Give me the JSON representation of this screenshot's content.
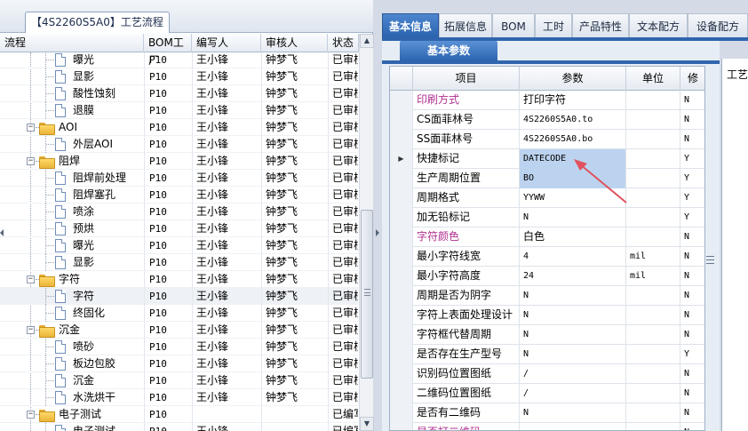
{
  "left_panel": {
    "tab_title": "【4S2260S5A0】工艺流程",
    "columns": [
      "流程",
      "BOM工厂",
      "编写人",
      "审核人",
      "状态"
    ],
    "rows": [
      {
        "kind": "leaf",
        "name": "曝光",
        "bom": "P10",
        "author": "王小锋",
        "reviewer": "钟梦飞",
        "status": "已审核"
      },
      {
        "kind": "leaf",
        "name": "显影",
        "bom": "P10",
        "author": "王小锋",
        "reviewer": "钟梦飞",
        "status": "已审核"
      },
      {
        "kind": "leaf",
        "name": "酸性蚀刻",
        "bom": "P10",
        "author": "王小锋",
        "reviewer": "钟梦飞",
        "status": "已审核"
      },
      {
        "kind": "leaf",
        "name": "退膜",
        "bom": "P10",
        "author": "王小锋",
        "reviewer": "钟梦飞",
        "status": "已审核"
      },
      {
        "kind": "folder",
        "name": "AOI",
        "bom": "P10",
        "author": "王小锋",
        "reviewer": "钟梦飞",
        "status": "已审核"
      },
      {
        "kind": "leaf",
        "name": "外层AOI",
        "bom": "P10",
        "author": "王小锋",
        "reviewer": "钟梦飞",
        "status": "已审核"
      },
      {
        "kind": "folder",
        "name": "阻焊",
        "bom": "P10",
        "author": "王小锋",
        "reviewer": "钟梦飞",
        "status": "已审核"
      },
      {
        "kind": "leaf",
        "name": "阻焊前处理",
        "bom": "P10",
        "author": "王小锋",
        "reviewer": "钟梦飞",
        "status": "已审核"
      },
      {
        "kind": "leaf",
        "name": "阻焊塞孔",
        "bom": "P10",
        "author": "王小锋",
        "reviewer": "钟梦飞",
        "status": "已审核"
      },
      {
        "kind": "leaf",
        "name": "喷涂",
        "bom": "P10",
        "author": "王小锋",
        "reviewer": "钟梦飞",
        "status": "已审核"
      },
      {
        "kind": "leaf",
        "name": "预烘",
        "bom": "P10",
        "author": "王小锋",
        "reviewer": "钟梦飞",
        "status": "已审核"
      },
      {
        "kind": "leaf",
        "name": "曝光",
        "bom": "P10",
        "author": "王小锋",
        "reviewer": "钟梦飞",
        "status": "已审核"
      },
      {
        "kind": "leaf",
        "name": "显影",
        "bom": "P10",
        "author": "王小锋",
        "reviewer": "钟梦飞",
        "status": "已审核"
      },
      {
        "kind": "folder",
        "name": "字符",
        "bom": "P10",
        "author": "王小锋",
        "reviewer": "钟梦飞",
        "status": "已审核"
      },
      {
        "kind": "leaf",
        "name": "字符",
        "bom": "P10",
        "author": "王小锋",
        "reviewer": "钟梦飞",
        "status": "已审核",
        "selected": true
      },
      {
        "kind": "leaf",
        "name": "终固化",
        "bom": "P10",
        "author": "王小锋",
        "reviewer": "钟梦飞",
        "status": "已审核"
      },
      {
        "kind": "folder",
        "name": "沉金",
        "bom": "P10",
        "author": "王小锋",
        "reviewer": "钟梦飞",
        "status": "已审核"
      },
      {
        "kind": "leaf",
        "name": "喷砂",
        "bom": "P10",
        "author": "王小锋",
        "reviewer": "钟梦飞",
        "status": "已审核"
      },
      {
        "kind": "leaf",
        "name": "板边包胶",
        "bom": "P10",
        "author": "王小锋",
        "reviewer": "钟梦飞",
        "status": "已审核"
      },
      {
        "kind": "leaf",
        "name": "沉金",
        "bom": "P10",
        "author": "王小锋",
        "reviewer": "钟梦飞",
        "status": "已审核"
      },
      {
        "kind": "leaf",
        "name": "水洗烘干",
        "bom": "P10",
        "author": "王小锋",
        "reviewer": "钟梦飞",
        "status": "已审核"
      },
      {
        "kind": "folder",
        "name": "电子测试",
        "bom": "P10",
        "author": "",
        "reviewer": "",
        "status": "已编写"
      },
      {
        "kind": "leaf",
        "name": "电子测试",
        "bom": "P10",
        "author": "王小锋",
        "reviewer": "",
        "status": "已编写"
      }
    ]
  },
  "main_tabs": [
    "基本信息",
    "拓展信息",
    "BOM",
    "工时",
    "产品特性",
    "文本配方",
    "设备配方"
  ],
  "active_main_tab": "基本信息",
  "sub_tab": "基本参数",
  "side_tab": "工艺",
  "grid": {
    "columns": [
      "项目",
      "参数",
      "单位",
      "修"
    ],
    "rows": [
      {
        "item": "印刷方式",
        "param": "打印字符",
        "unit": "",
        "mod": "N",
        "pink": true
      },
      {
        "item": "CS面菲林号",
        "param": "4S2260S5A0.to",
        "unit": "",
        "mod": "N"
      },
      {
        "item": "SS面菲林号",
        "param": "4S2260S5A0.bo",
        "unit": "",
        "mod": "N"
      },
      {
        "item": "快捷标记",
        "param": "DATECODE",
        "unit": "",
        "mod": "Y",
        "current": true,
        "selected": true
      },
      {
        "item": "生产周期位置",
        "param": "BO",
        "unit": "",
        "mod": "Y",
        "selected": true
      },
      {
        "item": "周期格式",
        "param": "YYWW",
        "unit": "",
        "mod": "Y"
      },
      {
        "item": "加无铅标记",
        "param": "N",
        "unit": "",
        "mod": "Y"
      },
      {
        "item": "字符颜色",
        "param": "白色",
        "unit": "",
        "mod": "N",
        "pink": true
      },
      {
        "item": "最小字符线宽",
        "param": "4",
        "unit": "mil",
        "mod": "N"
      },
      {
        "item": "最小字符高度",
        "param": "24",
        "unit": "mil",
        "mod": "N"
      },
      {
        "item": "周期是否为阴字",
        "param": "N",
        "unit": "",
        "mod": "N"
      },
      {
        "item": "字符上表面处理设计",
        "param": "N",
        "unit": "",
        "mod": "N"
      },
      {
        "item": "字符框代替周期",
        "param": "N",
        "unit": "",
        "mod": "N"
      },
      {
        "item": "是否存在生产型号",
        "param": "N",
        "unit": "",
        "mod": "Y"
      },
      {
        "item": "识别码位置图纸",
        "param": "/",
        "unit": "",
        "mod": "N"
      },
      {
        "item": "二维码位置图纸",
        "param": "/",
        "unit": "",
        "mod": "N"
      },
      {
        "item": "是否有二维码",
        "param": "N",
        "unit": "",
        "mod": "N"
      },
      {
        "item": "是否打二维码",
        "param": "",
        "unit": "",
        "mod": "N",
        "pink": true
      }
    ]
  },
  "colors": {
    "active_tab": "#2a62ad",
    "highlight_item": "#b0308f",
    "selected_cell": "#bcd3ef",
    "annotation_arrow": "#e0525e"
  }
}
